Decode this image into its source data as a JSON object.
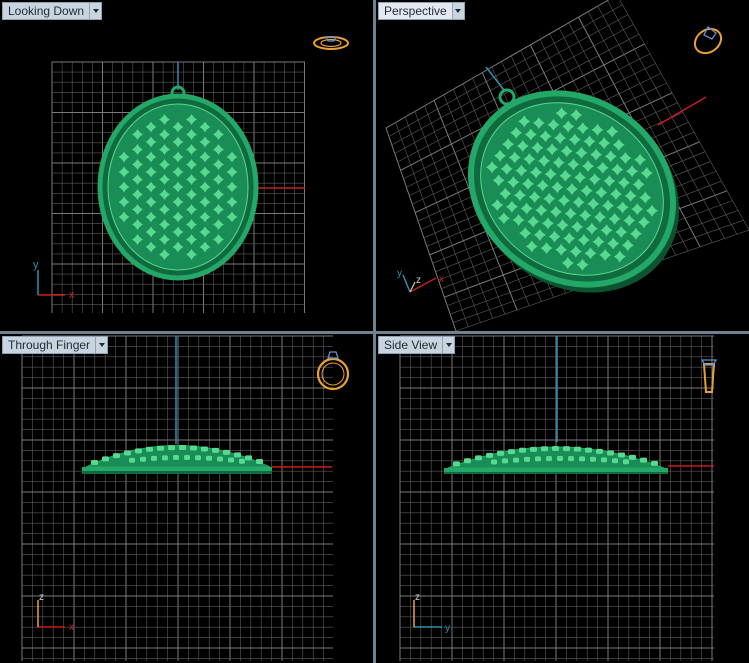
{
  "colors": {
    "grid": "#5c5c5c",
    "grid_major": "#7a7a7a",
    "model": "#23a867",
    "model_dark": "#0f6b3f",
    "model_light": "#57d98f",
    "axis_x": "#c81e1e",
    "axis_y": "#2f8fae",
    "gumball": "#e8a234",
    "frame": "#6f8291"
  },
  "viewports": [
    {
      "id": "top",
      "label": "Looking Down",
      "axis_labels": [
        "y",
        "x"
      ],
      "nav_icon": "ring-top-view-icon"
    },
    {
      "id": "persp",
      "label": "Perspective",
      "axis_labels": [
        "y",
        "z",
        "x"
      ],
      "nav_icon": "ring-perspective-view-icon"
    },
    {
      "id": "front",
      "label": "Through Finger",
      "axis_labels": [
        "z",
        "x"
      ],
      "nav_icon": "ring-front-view-icon"
    },
    {
      "id": "side",
      "label": "Side View",
      "axis_labels": [
        "z",
        "y"
      ],
      "nav_icon": "ring-side-view-icon"
    }
  ]
}
